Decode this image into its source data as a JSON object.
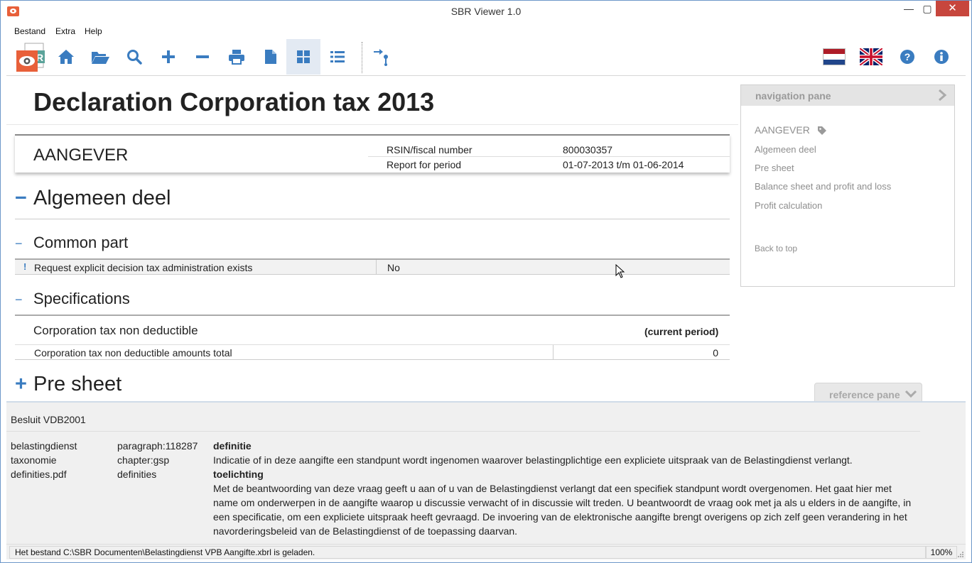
{
  "window": {
    "title": "SBR Viewer 1.0",
    "min_glyph": "—",
    "max_glyph": "▢",
    "close_glyph": "✕"
  },
  "menu": {
    "items": [
      "Bestand",
      "Extra",
      "Help"
    ]
  },
  "toolbar": {
    "buttons": [
      "home-icon",
      "open-folder-icon",
      "search-icon",
      "zoom-in-icon",
      "zoom-out-icon",
      "print-icon",
      "document-icon",
      "grid-view-icon",
      "list-view-icon",
      "navigate-pin-icon"
    ],
    "active": "grid-view-icon",
    "right_buttons": [
      "flag-nl-icon",
      "flag-uk-icon",
      "help-icon",
      "info-icon"
    ],
    "accent": "#3a7cc0"
  },
  "document": {
    "title": "Declaration Corporation tax 2013",
    "aangever": {
      "label": "AANGEVER",
      "rows": [
        {
          "key": "RSIN/fiscal number",
          "value": "800030357"
        },
        {
          "key": "Report for period",
          "value": "01-07-2013 t/m 01-06-2014"
        }
      ]
    },
    "sections": {
      "algemeen": {
        "sign": "−",
        "title": "Algemeen deel"
      },
      "common": {
        "sign": "−",
        "title": "Common part",
        "fact": {
          "mark": "!",
          "label": "Request explicit decision tax administration exists",
          "value": "No"
        }
      },
      "specifications": {
        "sign": "−",
        "title": "Specifications",
        "heading": "Corporation tax non deductible",
        "column": "(current period)",
        "row": {
          "label": "Corporation tax non deductible amounts total",
          "value": "0"
        }
      },
      "presheet": {
        "sign": "+",
        "title": "Pre sheet"
      }
    }
  },
  "navigation_pane": {
    "title": "navigation pane",
    "top_item": "AANGEVER",
    "items": [
      "Algemeen deel",
      "Pre sheet",
      "Balance sheet and profit and loss",
      "Profit calculation"
    ],
    "back": "Back to top"
  },
  "reference_pane": {
    "tab_label": "reference pane",
    "title": "Besluit VDB2001",
    "col1": [
      "belastingdienst",
      "taxonomie",
      "definities.pdf"
    ],
    "col2": [
      "paragraph:118287",
      "chapter:gsp",
      "definities"
    ],
    "definitie_term": "definitie",
    "definitie_text": "Indicatie of in deze aangifte een standpunt wordt ingenomen waarover belastingplichtige een expliciete uitspraak van de Belastingdienst verlangt.",
    "toelichting_term": "toelichting",
    "toelichting_text": "Met de beantwoording van deze vraag geeft u aan of u van de Belastingdienst verlangt dat een specifiek standpunt wordt overgenomen. Het gaat hier met name om onderwerpen in de aangifte waarop u discussie verwacht of in discussie wilt treden. U beantwoordt de vraag ook met ja als u elders in de aangifte, in een specificatie, om een expliciete uitspraak heeft gevraagd. De invoering van de elektronische aangifte brengt overigens op zich zelf geen verandering in het navorderingsbeleid van de Belastingdienst of de toepassing daarvan."
  },
  "statusbar": {
    "message": "Het bestand C:\\SBR Documenten\\Belastingdienst VPB Aangifte.xbrl is geladen.",
    "zoom": "100%"
  }
}
